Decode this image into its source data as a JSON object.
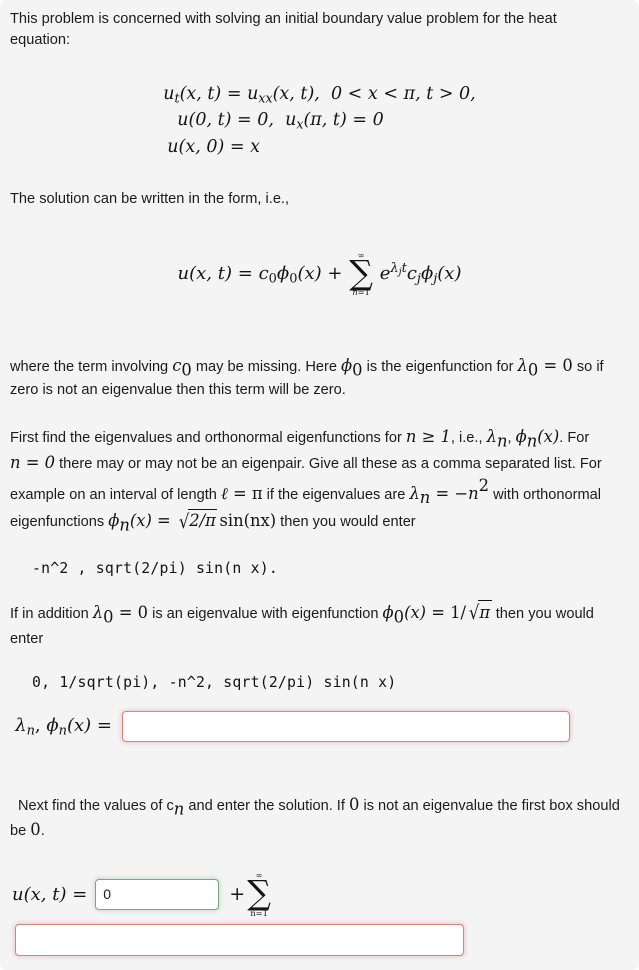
{
  "problem": {
    "intro": "This problem is concerned with solving an initial boundary value problem for the heat equation:",
    "pde": {
      "line1": {
        "lhs_fn": "u",
        "lhs_sub": "t",
        "lhs_args": "(x, t)",
        "eq": "=",
        "rhs_fn": "u",
        "rhs_sub": "xx",
        "rhs_args": "(x, t),",
        "domain_x": "0 < x < π,",
        "domain_t": "t > 0,"
      },
      "line2": {
        "bc1": "u(0, t) = 0,",
        "bc2_fn": "u",
        "bc2_sub": "x",
        "bc2_rest": "(π, t) = 0"
      },
      "line3": "u(x, 0) = x"
    },
    "form_intro": "The solution can be written in the form, i.e.,",
    "solution_form": {
      "lhs": "u(x, t)",
      "eq": "=",
      "first_term_c": "c",
      "first_term_c_sub": "0",
      "first_term_phi": "ϕ",
      "first_term_phi_sub": "0",
      "first_term_arg": "(x)",
      "plus": "+",
      "sum_top": "∞",
      "sum_sigma": "∑",
      "sum_bottom_var": "n",
      "sum_bottom_eq": "=",
      "sum_bottom_val": "1",
      "exp_base": "e",
      "exp_lambda": "λ",
      "exp_lambda_sub": "j",
      "exp_t": "t",
      "coeff_c": "c",
      "coeff_c_sub": "j",
      "eigen_phi": "ϕ",
      "eigen_phi_sub": "j",
      "eigen_arg": "(x)"
    },
    "note_para": {
      "a": "where the term involving ",
      "c0_c": "c",
      "c0_sub": "0",
      "b": " may be missing. Here ",
      "phi0_phi": "ϕ",
      "phi0_sub": "0",
      "c": " is the eigenfunction for ",
      "lam0_lam": "λ",
      "lam0_sub": "0",
      "lam0_eq": " = ",
      "lam0_val": "0",
      "d": " so if zero is not an eigenvalue then this term will be zero."
    },
    "instructions": {
      "a": "First find the eigenvalues and orthonormal eigenfunctions for ",
      "n_ge": "n ≥ 1",
      "b": ", i.e., ",
      "lam_n_l": "λ",
      "lam_n_sub": "n",
      "b2": ", ",
      "phi_n_p": "ϕ",
      "phi_n_sub": "n",
      "phi_n_arg": "(x)",
      "c": ". For ",
      "n_eq_0": "n = 0",
      "d": " there may or may not be an eigenpair. Give all these as a comma separated list. For example on an interval of length ",
      "ell": "ℓ",
      "ell_eq": " = ",
      "ell_val": "π",
      "e": " if the eigenvalues are ",
      "lam_ex_l": "λ",
      "lam_ex_sub": "n",
      "lam_ex_eq": " = ",
      "lam_ex_rhs": "−n",
      "lam_ex_pow": "2",
      "f": " with orthonormal eigenfunctions ",
      "phi_ex_p": "ϕ",
      "phi_ex_sub": "n",
      "phi_ex_arg": "(x)",
      "phi_ex_eq": " = ",
      "sqrt_sym": "√",
      "sqrt_radicand": "2/π",
      "sin_part": "sin(nx)",
      "g": " then you would enter"
    },
    "example_1": "-n^2 , sqrt(2/pi) sin(n x)",
    "example_1_tail": ".",
    "addition_para": {
      "a": "If in addition ",
      "lam0_l": "λ",
      "lam0_sub": "0",
      "lam0_eq": " = ",
      "lam0_val": "0",
      "b": " is an eigenvalue with eigenfunction ",
      "phi0_p": "ϕ",
      "phi0_sub": "0",
      "phi0_arg": "(x)",
      "phi0_eq": " = ",
      "one_over": "1/",
      "sqrt_sym": "√",
      "sqrt_radicand": "π",
      "c": " then you would enter"
    },
    "example_2": "0, 1/sqrt(pi), -n^2, sqrt(2/pi) sin(n x)"
  },
  "answers": {
    "eigen": {
      "label_lam": "λ",
      "label_lam_sub": "n",
      "label_comma": ", ",
      "label_phi": "ϕ",
      "label_phi_sub": "n",
      "label_arg": "(x)",
      "label_eq": " =",
      "value": "",
      "status": "incorrect",
      "border_color": "#d9837f"
    },
    "solution": {
      "prompt": "Next find the values of c",
      "prompt_sub": "n",
      "prompt_b": " and enter the solution. If ",
      "prompt_zero": "0",
      "prompt_c": " is not an eigenvalue the first box should be ",
      "prompt_zero2": "0",
      "prompt_d": ".",
      "lhs": "u(x, t)",
      "lhs_eq": "=",
      "c0_value": "0",
      "c0_status": "correct",
      "c0_border_color": "#74ab74",
      "plus": "+",
      "sum_top": "∞",
      "sum_sigma": "∑",
      "sum_bottom": "n=1",
      "series_value": "",
      "series_status": "incorrect",
      "series_border_color": "#d9837f"
    }
  },
  "theme": {
    "page_background": "#f4f4f4",
    "text_color": "#1b1b1b",
    "math_color": "#141414",
    "input_background": "#ffffff"
  }
}
